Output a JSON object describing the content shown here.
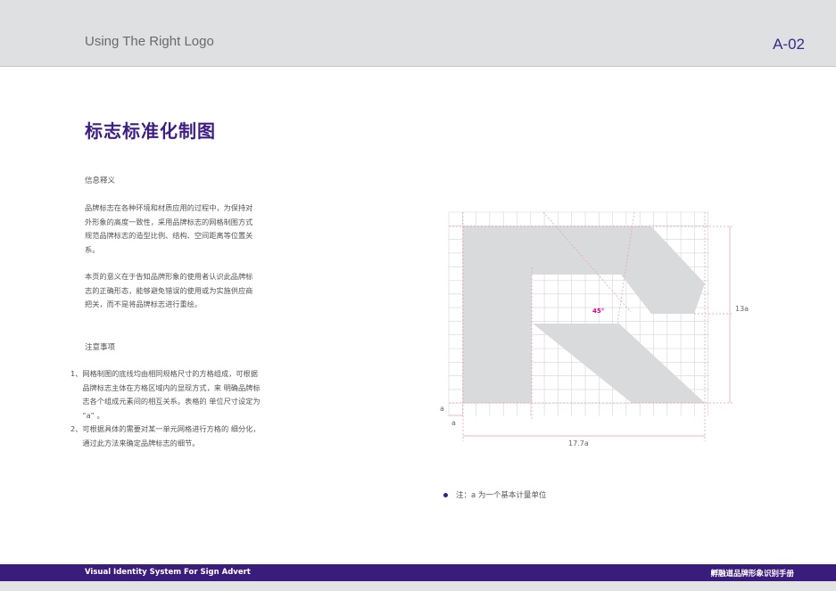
{
  "header": {
    "title": "Using The Right Logo",
    "page_code": "A-02"
  },
  "main": {
    "title": "标志标准化制图",
    "section1_title": "信息释义",
    "para1": "品牌标志在各种环境和材质应用的过程中，为保持对外形象的高度一致性，采用品牌标志的网格制图方式规范品牌标志的造型比例、结构、空间距离等位置关系。",
    "para2": "本页的意义在于告知品牌形象的使用者认识此品牌标志的正确形态，能够避免错误的使用或为实施供应商把关，而不是将品牌标志进行重绘。",
    "section2_title": "注意事项",
    "items": [
      {
        "num": "1、",
        "text": "网格制图的底线均由相同规格尺寸的方格组成，可根据品牌标志主体在方格区域内的显现方式，来 明确品牌标志各个组成元素间的相互关系。表格的 单位尺寸设定为 “a” 。"
      },
      {
        "num": "2、",
        "text": "可根据具体的需要对某一单元网格进行方格的 细分化，通过此方法来确定品牌标志的细节。"
      }
    ]
  },
  "diagram": {
    "angle_label": "45°",
    "height_label": "13a",
    "width_label": "17.7a",
    "unit_label_side": "a",
    "unit_label_bottom": "a",
    "logo_color": "#d9dadb",
    "angle_color": "#e4007f"
  },
  "note": "注：a 为一个基本计量单位",
  "footer": {
    "left": "Visual Identity System For Sign Advert",
    "right": "孵融道品牌形象识别手册"
  }
}
